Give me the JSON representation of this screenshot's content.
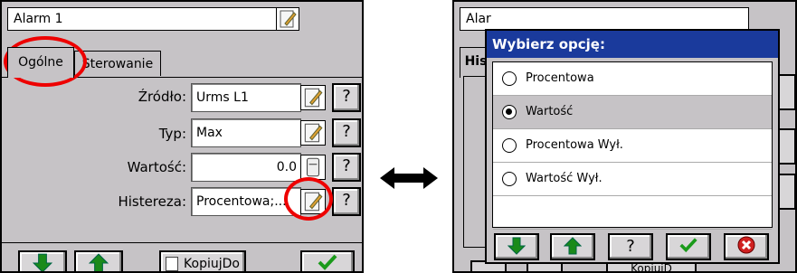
{
  "left": {
    "title": "Alarm 1",
    "tabs": [
      "Ogólne",
      "Sterowanie"
    ],
    "rows": [
      {
        "label": "Źródło:",
        "value": "Urms L1"
      },
      {
        "label": "Typ:",
        "value": "Max"
      },
      {
        "label": "Wartość:",
        "value": "0.0"
      },
      {
        "label": "Histereza:",
        "value": "Procentowa;..."
      }
    ],
    "help_glyph": "?",
    "bottom": {
      "copy_label": "KopiujDo"
    }
  },
  "right": {
    "title_partial": "Alar",
    "tab_partial": "His",
    "dialog": {
      "title": "Wybierz opcję:",
      "options": [
        "Procentowa",
        "Wartość",
        "Procentowa Wył.",
        "Wartość Wył."
      ],
      "selected": 1,
      "help_glyph": "?"
    },
    "behind_copy_partial": "KopiujD"
  },
  "colors": {
    "accent_ring": "#e00000",
    "dialog_title": "#1a3a9c",
    "selected_row": "#c6c3c6"
  }
}
